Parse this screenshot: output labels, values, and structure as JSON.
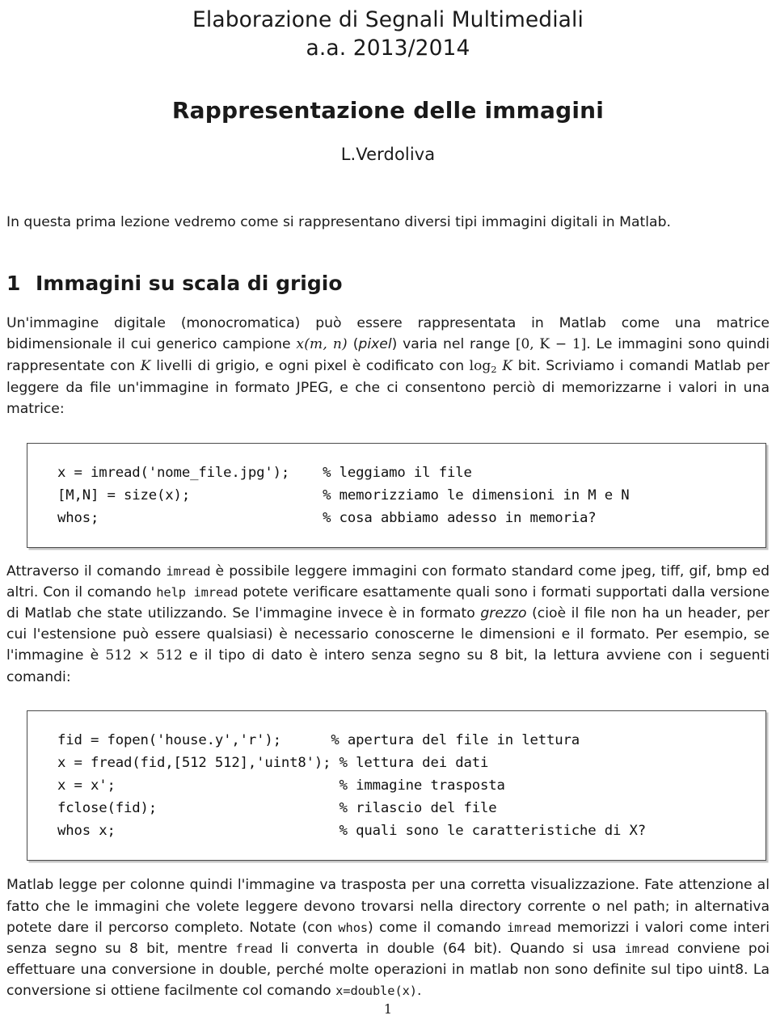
{
  "header": {
    "course_line1": "Elaborazione di Segnali Multimediali",
    "course_line2": "a.a. 2013/2014",
    "doc_title": "Rappresentazione delle immagini",
    "author": "L.Verdoliva"
  },
  "intro": "In questa prima lezione vedremo come si rappresentano diversi tipi immagini digitali in Matlab.",
  "section1": {
    "number": "1",
    "title": "Immagini su scala di grigio",
    "paragraph_segments": {
      "p1_a": "Un'immagine digitale (monocromatica) può essere rappresentata in Matlab come una matrice bidimensionale il cui generico campione ",
      "p1_math_x": "x(m, n)",
      "p1_b": " (",
      "p1_ital_pixel": "pixel",
      "p1_c": ") varia nel range ",
      "p1_math_range": "[0, K − 1]",
      "p1_d": ". Le immagini sono quindi rappresentate con ",
      "p1_math_K": "K",
      "p1_e": " livelli di grigio, e ogni pixel è codificato con ",
      "p1_math_log": "log",
      "p1_math_log_sub": "2",
      "p1_math_log_K": " K",
      "p1_f": " bit. Scriviamo i comandi Matlab per leggere da file un'immagine in formato JPEG, e che ci consentono perciò di memorizzarne i valori in una matrice:"
    }
  },
  "code_block_1": "x = imread('nome_file.jpg');    % leggiamo il file\n[M,N] = size(x);                % memorizziamo le dimensioni in M e N\nwhos;                           % cosa abbiamo adesso in memoria?",
  "paragraph2_segments": {
    "a": "Attraverso il comando ",
    "tt1": "imread",
    "b": " è possibile leggere immagini con formato standard come jpeg, tiff, gif, bmp ed altri. Con il comando ",
    "tt2": "help imread",
    "c": " potete verificare esattamente quali sono i formati supportati dalla versione di Matlab che state utilizzando. Se l'immagine invece è in formato ",
    "ital1": "grezzo",
    "d": " (cioè il file non ha un header, per cui l'estensione può essere qualsiasi) è necessario conoscerne le dimensioni e il formato. Per esempio, se l'immagine è ",
    "math1": "512 × 512",
    "e": " e il tipo di dato è intero senza segno su 8 bit, la lettura avviene con i seguenti comandi:"
  },
  "code_block_2": "fid = fopen('house.y','r');      % apertura del file in lettura\nx = fread(fid,[512 512],'uint8'); % lettura dei dati\nx = x';                           % immagine trasposta\nfclose(fid);                      % rilascio del file\nwhos x;                           % quali sono le caratteristiche di X?",
  "paragraph3_segments": {
    "a": "Matlab legge per colonne quindi l'immagine va trasposta per una corretta visualizzazione. Fate attenzione al fatto che le immagini che volete leggere devono trovarsi nella directory corrente o nel path; in alternativa potete dare il percorso completo. Notate (con ",
    "tt1": "whos",
    "b": ") come il comando ",
    "tt2": "imread",
    "c": " memorizzi i valori come interi senza segno su 8 bit, mentre ",
    "tt3": "fread",
    "d": " li converta in double (64 bit). Quando si usa ",
    "tt4": "imread",
    "e": " conviene poi effettuare una conversione in double, perché molte operazioni in matlab non sono definite sul tipo uint8. La conversione si ottiene facilmente col comando ",
    "tt5": "x=double(x)",
    "f": "."
  },
  "page_number": "1"
}
